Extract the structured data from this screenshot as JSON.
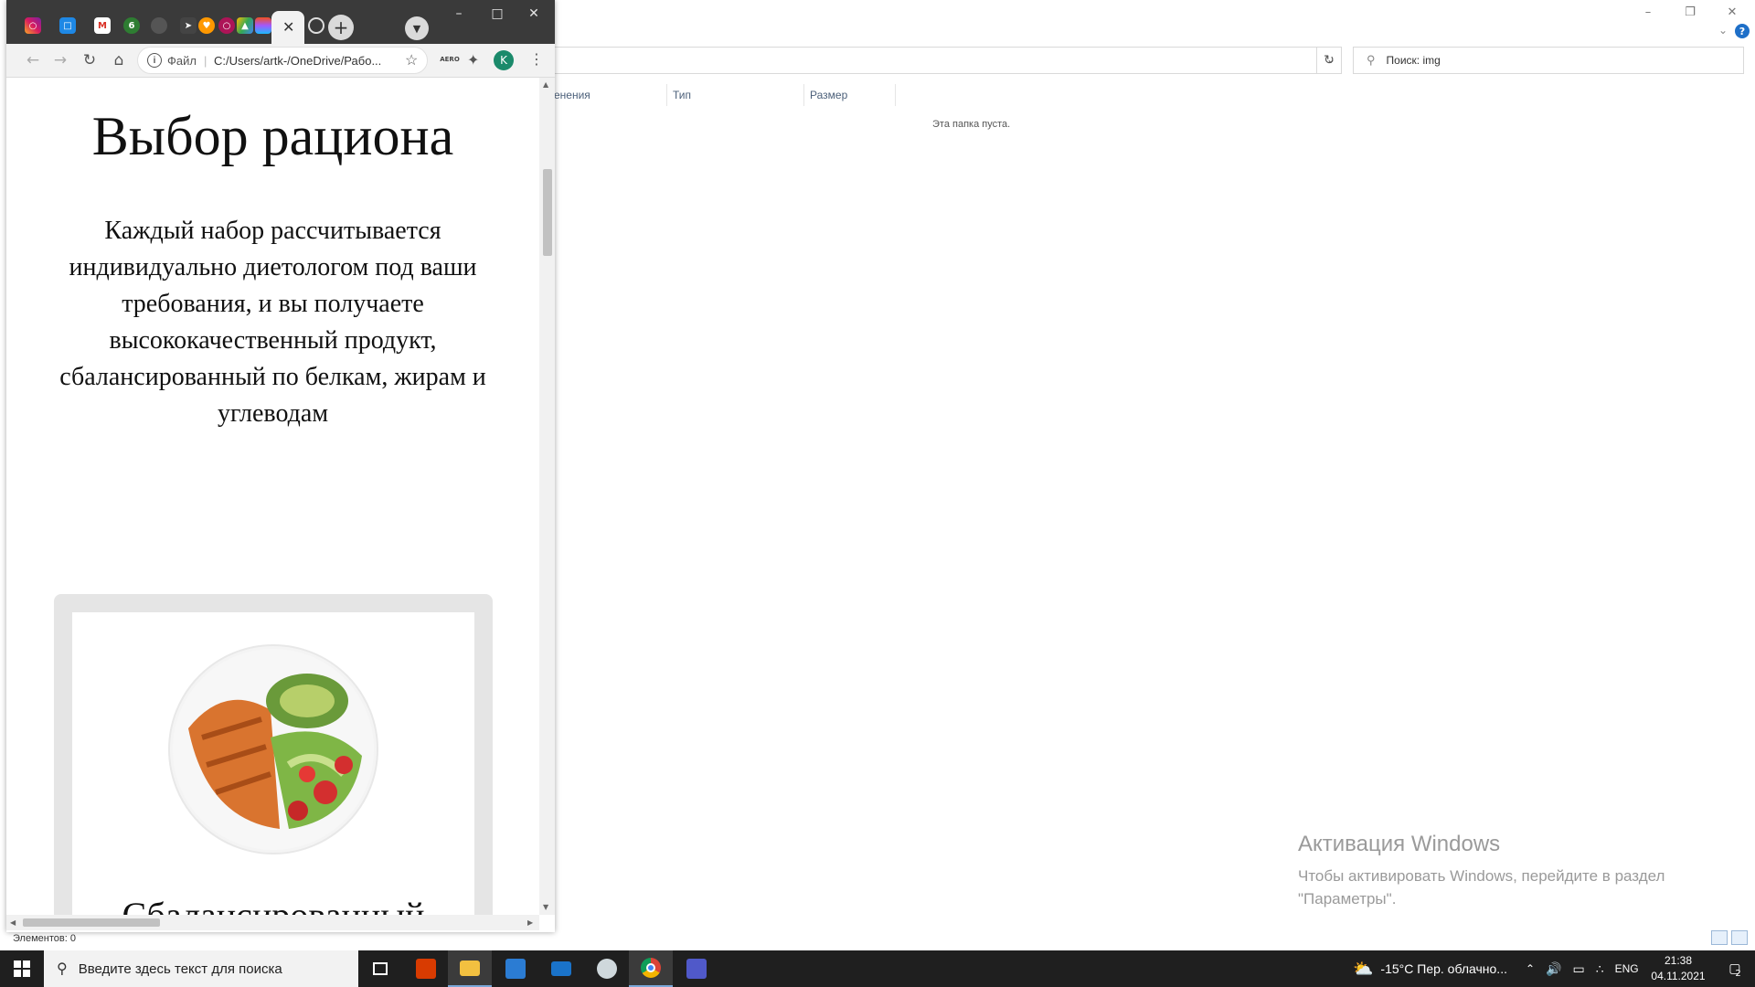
{
  "explorer": {
    "search_placeholder": "Поиск: img",
    "columns": [
      "енения",
      "Тип",
      "Размер"
    ],
    "empty_message": "Эта папка пуста.",
    "status": "Элементов: 0",
    "help": "?"
  },
  "activation": {
    "title": "Активация Windows",
    "subtitle": "Чтобы активировать Windows, перейдите в раздел \"Параметры\"."
  },
  "chrome": {
    "omnibox": {
      "scheme": "Файл",
      "url": "C:/Users/artk-/OneDrive/Рабо..."
    },
    "profile_initial": "K",
    "extension_label": "AERO"
  },
  "page": {
    "title": "Выбор рациона",
    "description": "Каждый набор рассчитывается индивидуально диетологом под ваши требования, и вы получаете высококачественный продукт, сбалансированный по белкам, жирам и углеводам",
    "card_title": "Сбалансированный"
  },
  "taskbar": {
    "search_placeholder": "Введите здесь текст для поиска",
    "weather": "-15°C  Пер. облачно...",
    "language": "ENG",
    "time": "21:38",
    "date": "04.11.2021",
    "notifications": "2"
  }
}
